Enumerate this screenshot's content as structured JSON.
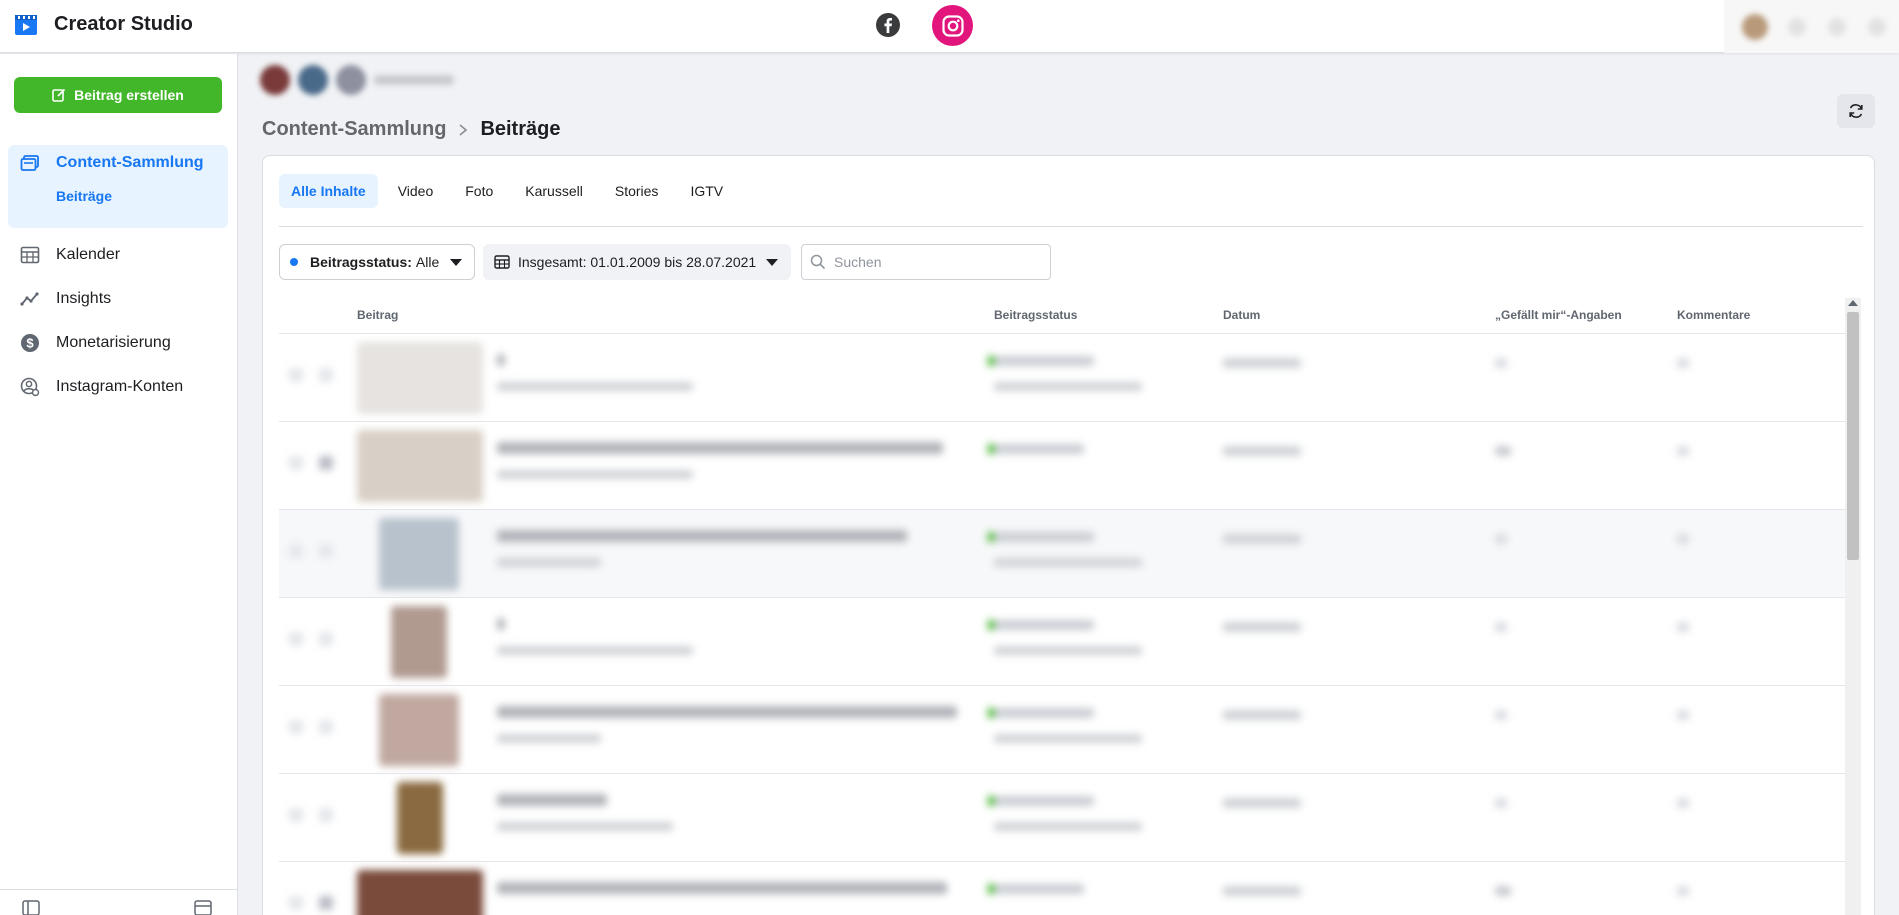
{
  "app": {
    "title": "Creator Studio"
  },
  "sidebar": {
    "create_label": "Beitrag erstellen",
    "nav": [
      {
        "label": "Content-Sammlung",
        "icon": "content-library-icon",
        "active": true
      },
      {
        "label": "Kalender",
        "icon": "calendar-icon"
      },
      {
        "label": "Insights",
        "icon": "insights-icon"
      },
      {
        "label": "Monetarisierung",
        "icon": "dollar-icon"
      },
      {
        "label": "Instagram-Konten",
        "icon": "account-settings-icon"
      }
    ],
    "sub_item": "Beiträge"
  },
  "breadcrumb": {
    "parent": "Content-Sammlung",
    "current": "Beiträge"
  },
  "tabs": [
    "Alle Inhalte",
    "Video",
    "Foto",
    "Karussell",
    "Stories",
    "IGTV"
  ],
  "filters": {
    "status_label": "Beitragsstatus:",
    "status_value": "Alle",
    "date_range": "Insgesamt: 01.01.2009 bis 28.07.2021",
    "search_placeholder": "Suchen"
  },
  "table": {
    "columns": [
      "Beitrag",
      "Beitragsstatus",
      "Datum",
      "„Gefällt mir“-Angaben",
      "Kommentare"
    ]
  },
  "colors": {
    "accent": "#1877f2",
    "create_button": "#42b72a",
    "instagram": "#e1157c"
  }
}
